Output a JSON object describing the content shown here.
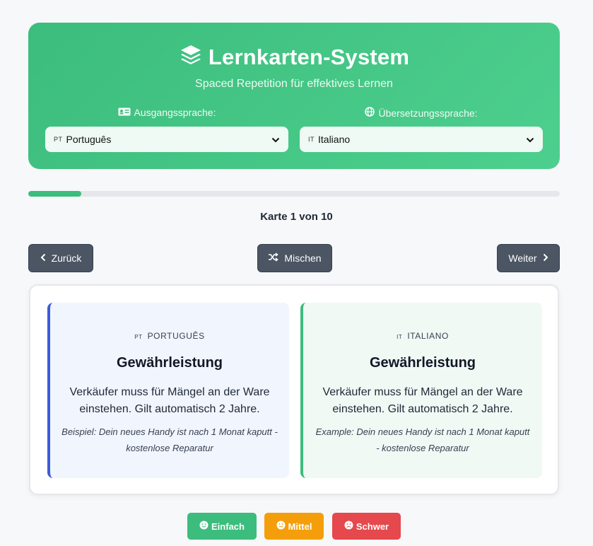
{
  "header": {
    "title": "Lernkarten-System",
    "subtitle": "Spaced Repetition für effektives Lernen",
    "icon": "layers-icon",
    "source_label": "Ausgangssprache:",
    "target_label": "Übersetzungssprache:",
    "source_select": {
      "code": "PT",
      "value": "Português"
    },
    "target_select": {
      "code": "IT",
      "value": "Italiano"
    }
  },
  "progress": {
    "fraction": 0.1
  },
  "counter": "Karte 1 von 10",
  "nav": {
    "prev": "Zurück",
    "shuffle": "Mischen",
    "next": "Weiter"
  },
  "card": {
    "front": {
      "lang_code": "PT",
      "lang": "PORTUGUÊS",
      "word": "Gewährleistung",
      "definition": "Verkäufer muss für Mängel an der Ware einstehen. Gilt automatisch 2 Jahre.",
      "example": "Beispiel: Dein neues Handy ist nach 1 Monat kaputt - kostenlose Reparatur"
    },
    "back": {
      "lang_code": "IT",
      "lang": "ITALIANO",
      "word": "Gewährleistung",
      "definition": "Verkäufer muss für Mängel an der Ware einstehen. Gilt automatisch 2 Jahre.",
      "example": "Example: Dein neues Handy ist nach 1 Monat kaputt - kostenlose Reparatur"
    }
  },
  "rating": {
    "easy": "Einfach",
    "medium": "Mittel",
    "hard": "Schwer"
  },
  "colors": {
    "accent": "#3cbd7d",
    "nav_button": "#4b5563",
    "easy": "#3cbd7d",
    "medium": "#f59e0b",
    "hard": "#e5484d",
    "front_border": "#3b5bdb"
  }
}
